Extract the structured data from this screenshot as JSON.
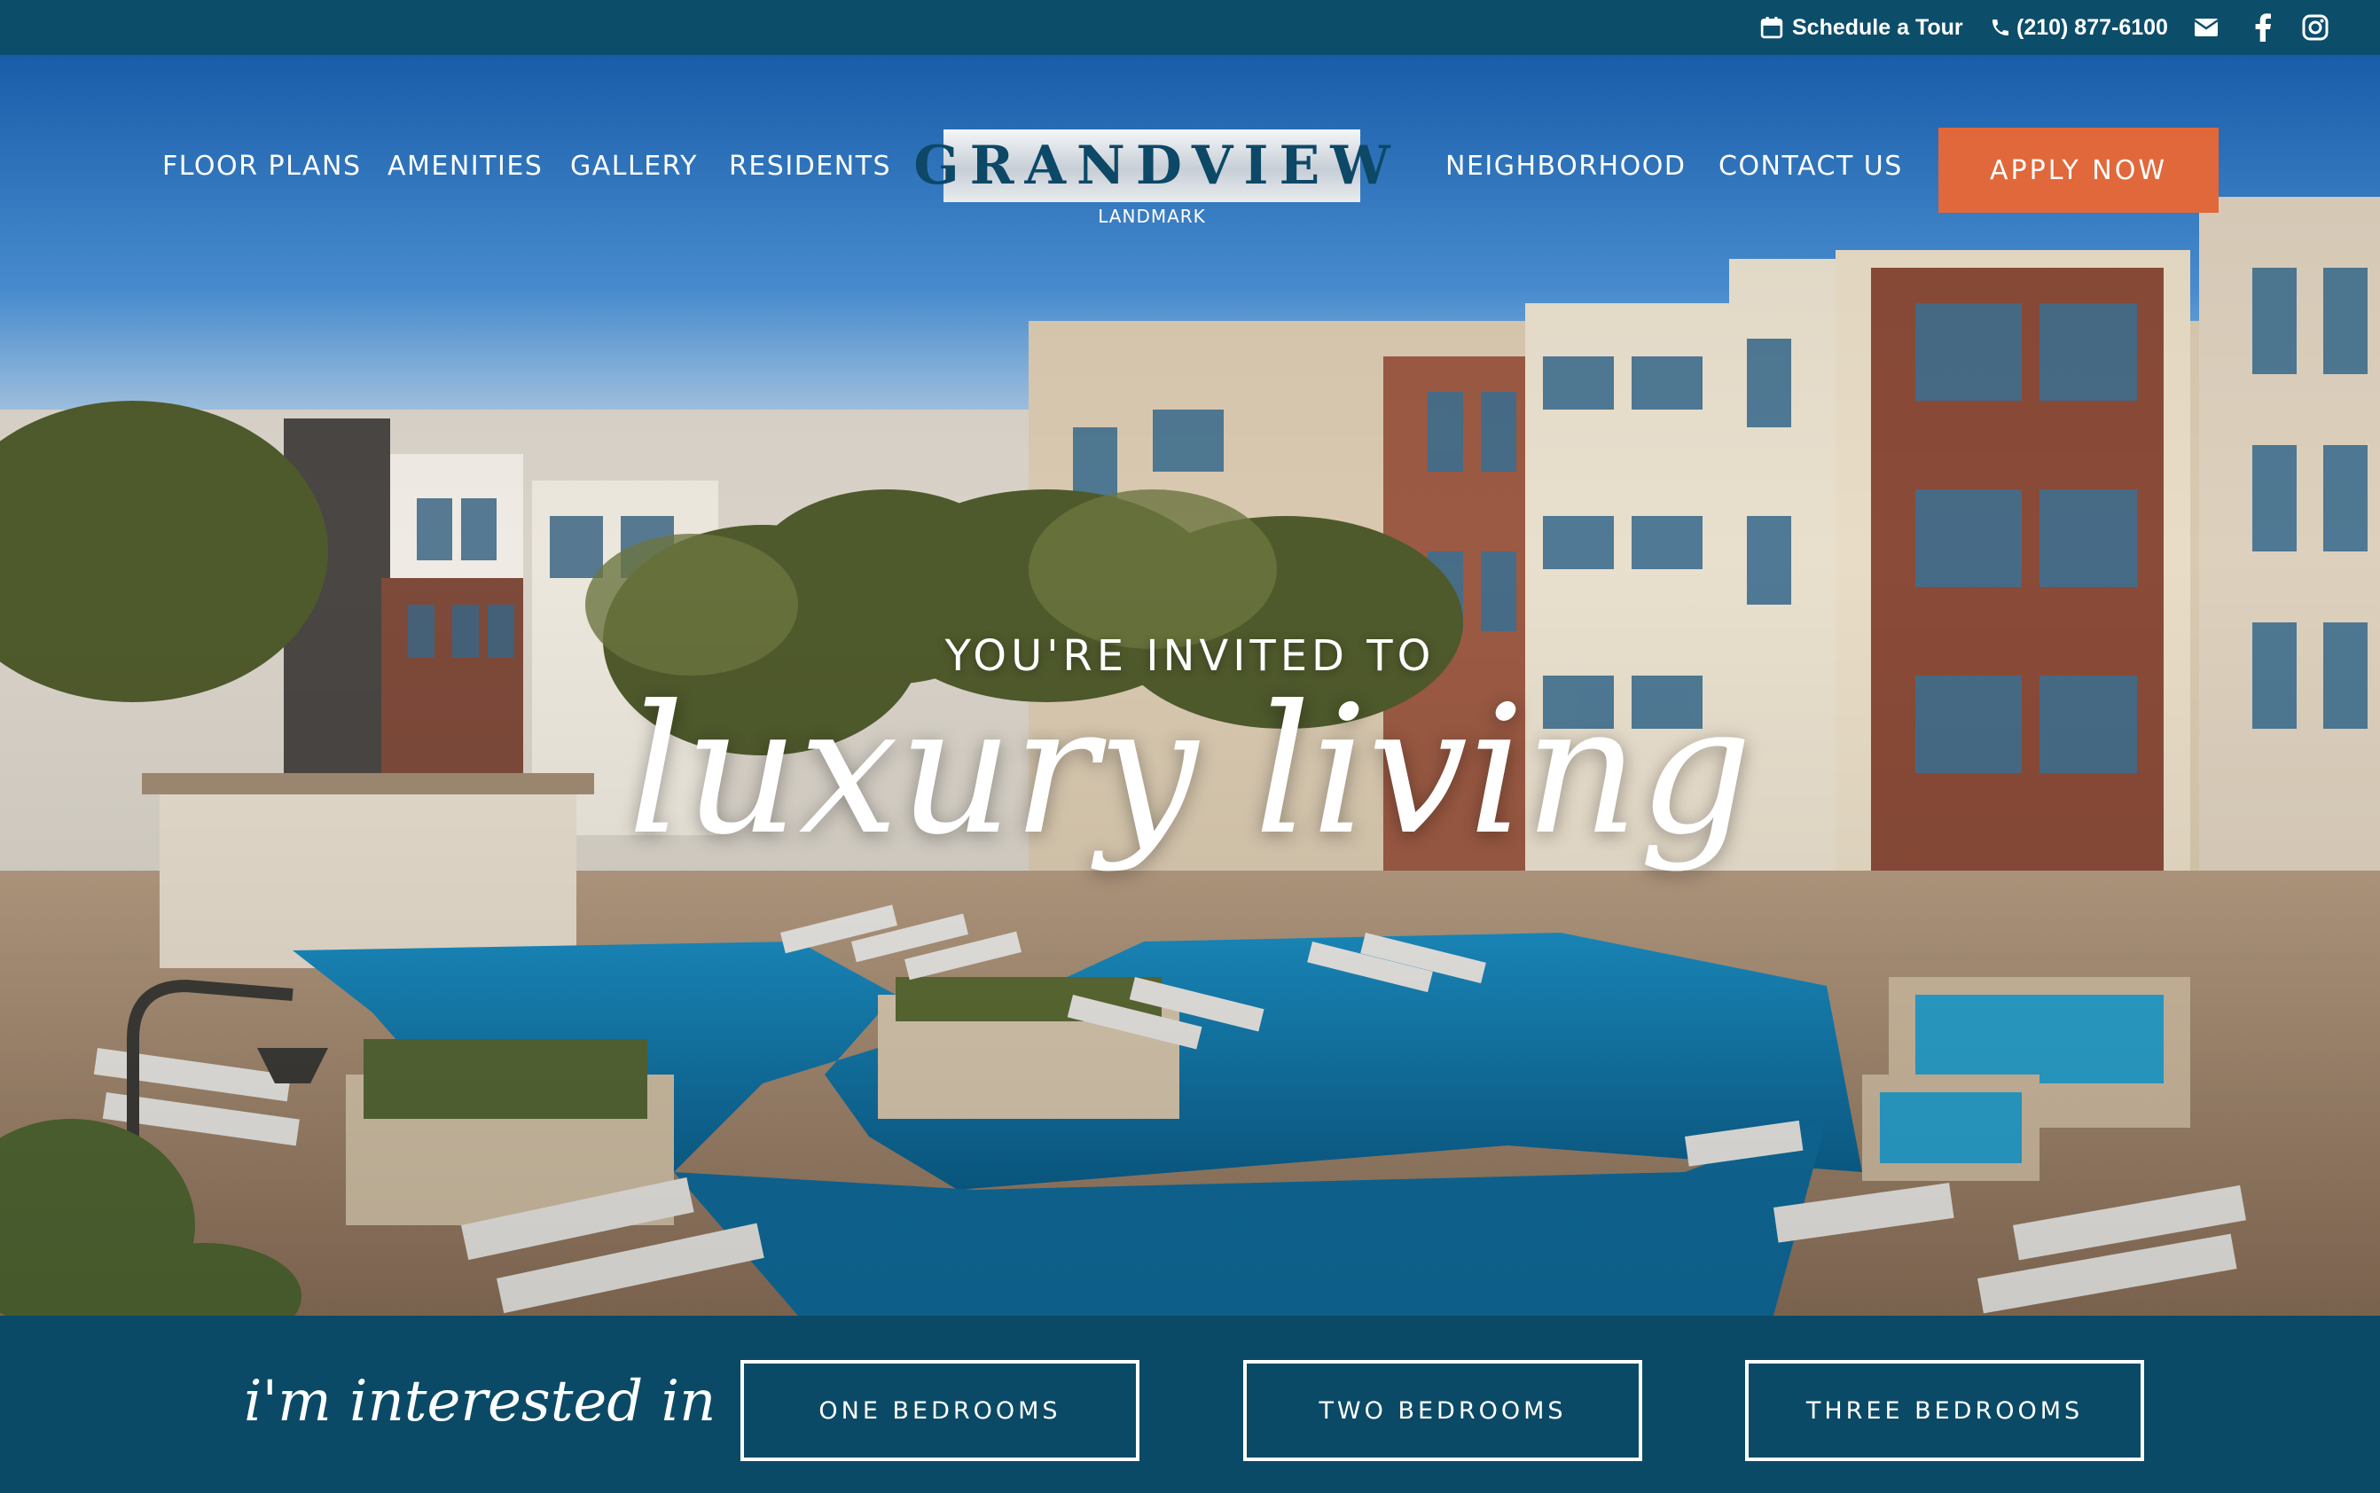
{
  "topbar": {
    "schedule_label": "Schedule a Tour",
    "phone": "(210) 877-6100",
    "icons": [
      "calendar-icon",
      "phone-icon",
      "mail-icon",
      "facebook-icon",
      "instagram-icon"
    ]
  },
  "nav": {
    "left": [
      {
        "label": "FLOOR PLANS"
      },
      {
        "label": "AMENITIES"
      },
      {
        "label": "GALLERY"
      },
      {
        "label": "RESIDENTS"
      }
    ],
    "right": [
      {
        "label": "NEIGHBORHOOD"
      },
      {
        "label": "CONTACT US"
      }
    ],
    "apply_label": "APPLY NOW"
  },
  "logo": {
    "name": "GRANDVIEW",
    "subtitle": "LANDMARK"
  },
  "hero": {
    "kicker": "YOU'RE INVITED TO",
    "headline": "luxury living"
  },
  "interest": {
    "label": "i'm interested in",
    "buttons": [
      {
        "label": "ONE BEDROOMS"
      },
      {
        "label": "TWO BEDROOMS"
      },
      {
        "label": "THREE BEDROOMS"
      }
    ]
  },
  "colors": {
    "brand_dark": "#0c4d6a",
    "accent": "#e1683a",
    "white": "#ffffff"
  }
}
